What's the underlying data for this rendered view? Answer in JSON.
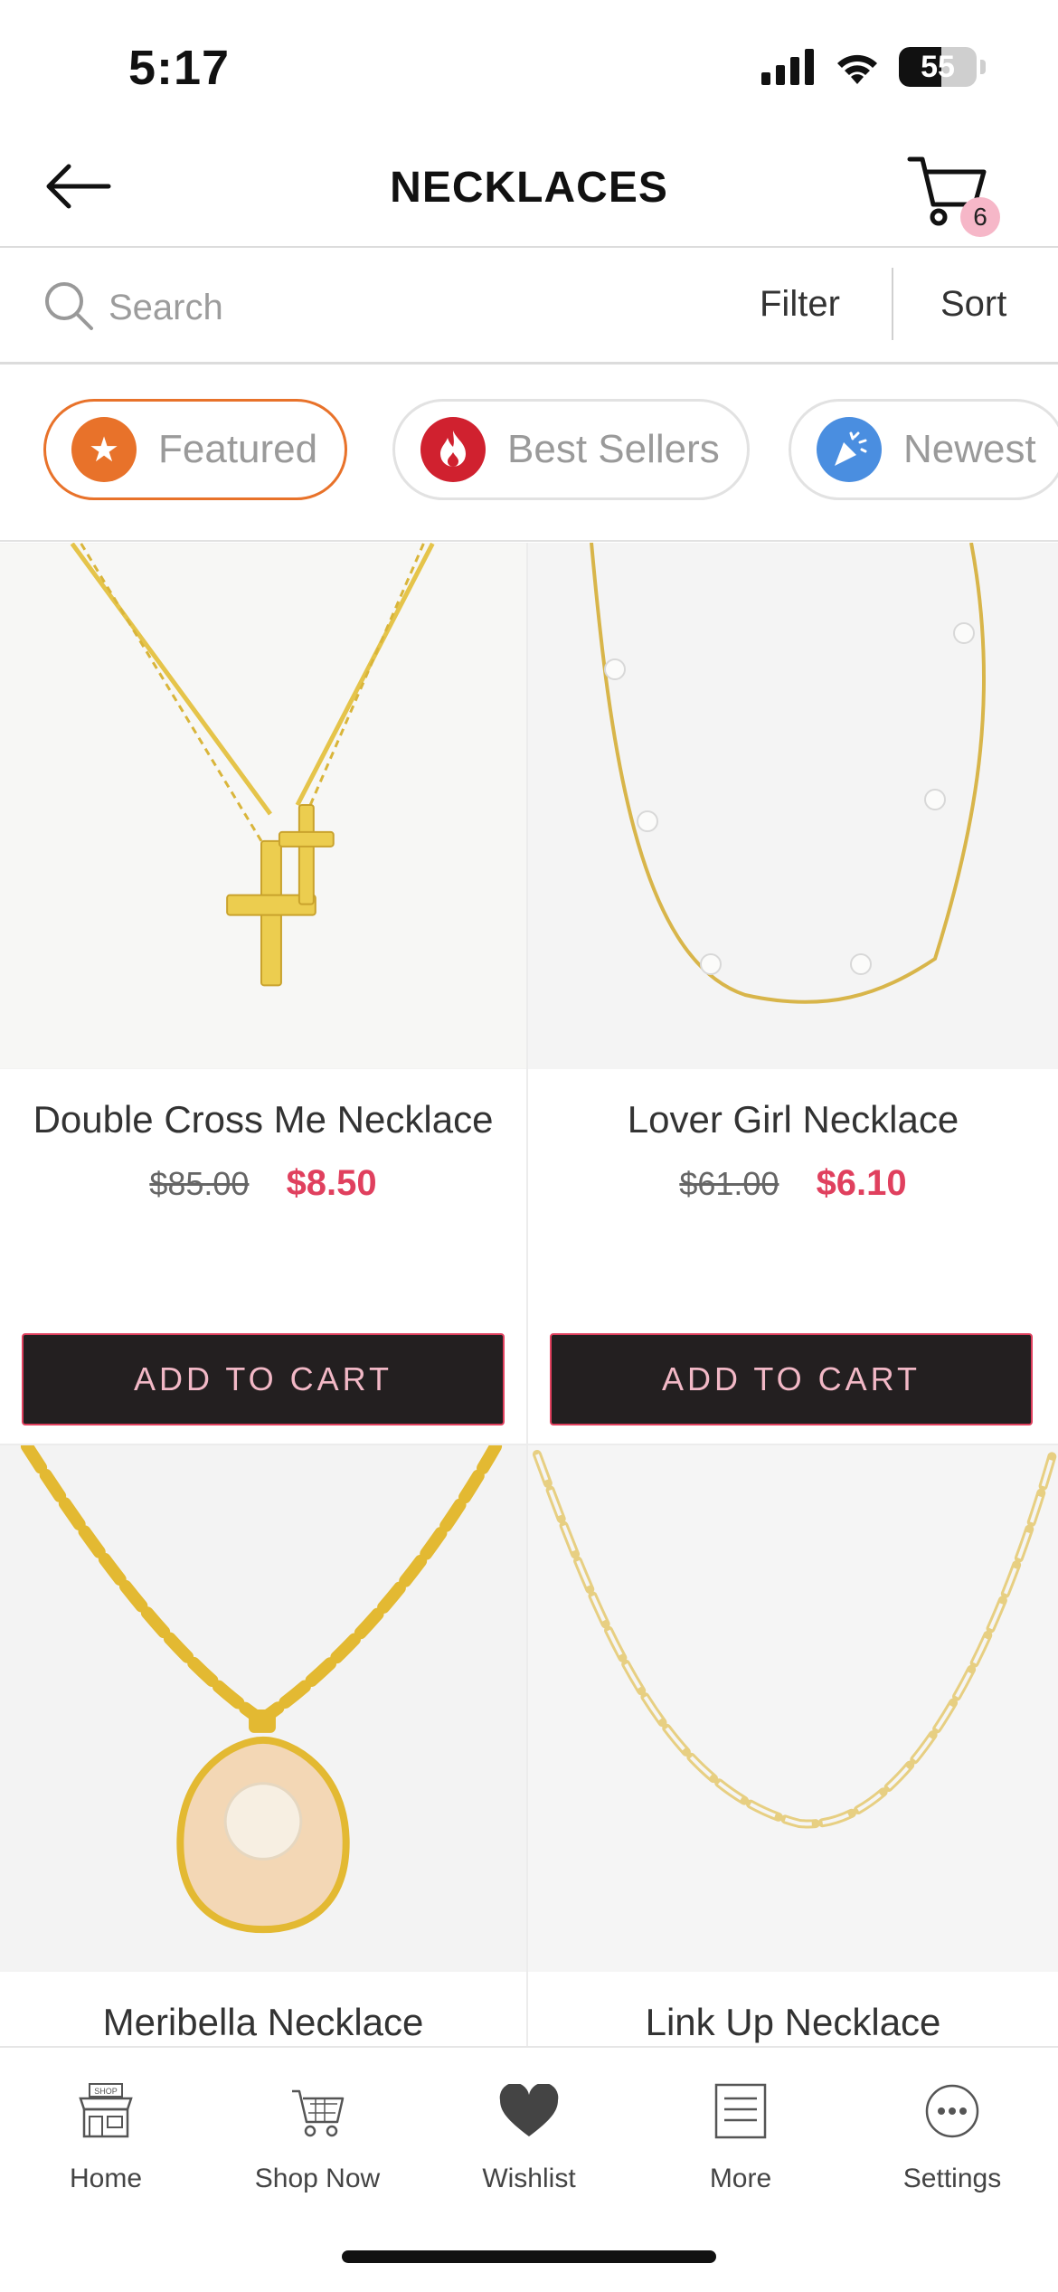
{
  "status_bar": {
    "time": "5:17",
    "battery": "55"
  },
  "header": {
    "title": "NECKLACES",
    "cart_count": "6"
  },
  "search": {
    "placeholder": "Search",
    "filter_label": "Filter",
    "sort_label": "Sort"
  },
  "chips": [
    {
      "label": "Featured",
      "icon": "star-icon",
      "color": "#e8722a",
      "active": true
    },
    {
      "label": "Best Sellers",
      "icon": "flame-icon",
      "color": "#d0212f",
      "active": false
    },
    {
      "label": "Newest",
      "icon": "party-popper-icon",
      "color": "#4a8ee0",
      "active": false
    }
  ],
  "products": [
    {
      "name": "Double Cross Me Necklace",
      "old_price": "$85.00",
      "price": "$8.50",
      "cta": "ADD TO CART"
    },
    {
      "name": "Lover Girl Necklace",
      "old_price": "$61.00",
      "price": "$6.10",
      "cta": "ADD TO CART"
    },
    {
      "name": "Meribella Necklace"
    },
    {
      "name": "Link Up Necklace"
    }
  ],
  "tabs": [
    {
      "label": "Home",
      "icon": "shop-storefront-icon"
    },
    {
      "label": "Shop Now",
      "icon": "shopping-cart-icon"
    },
    {
      "label": "Wishlist",
      "icon": "heart-icon"
    },
    {
      "label": "More",
      "icon": "list-icon"
    },
    {
      "label": "Settings",
      "icon": "more-dots-icon"
    }
  ],
  "colors": {
    "accent": "#e8722a",
    "sale": "#e0405e",
    "button_bg": "#231f20",
    "button_text": "#f2b8c6"
  }
}
